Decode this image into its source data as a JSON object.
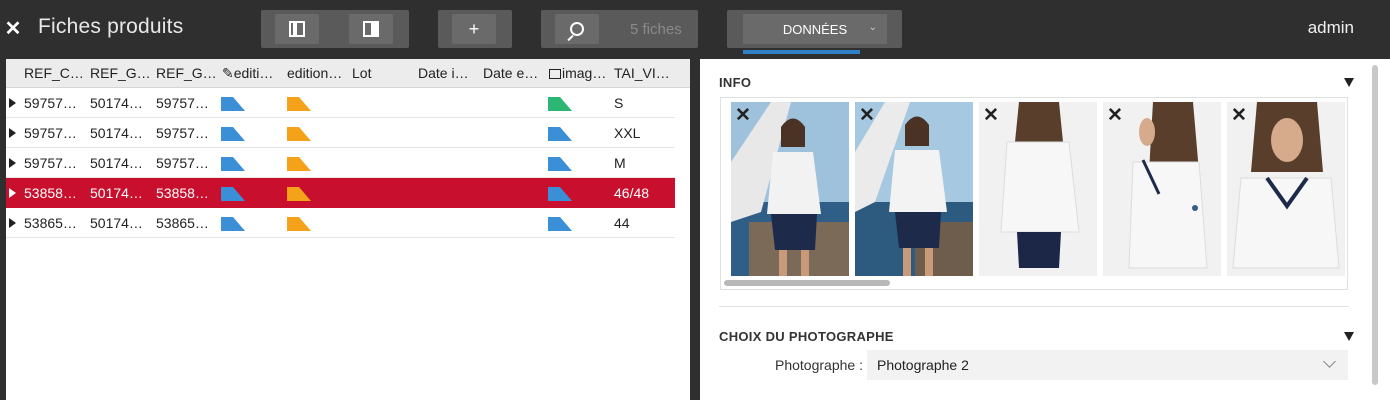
{
  "topbar": {
    "close_label": "✕",
    "title": "Fiches produits",
    "add_label": "+",
    "count_label": "5 fiches",
    "data_tab_label": "DONNÉES",
    "user": "admin"
  },
  "grid": {
    "columns": [
      "REF_C…",
      "REF_G…",
      "REF_G…",
      "editi…",
      "edition…",
      "Lot",
      "Date i…",
      "Date e…",
      "imag…",
      "TAI_VI…"
    ],
    "rows": [
      {
        "c1": "59757…",
        "c2": "50174…",
        "c3": "59757…",
        "size": "S",
        "image_flag_color": "#2bb673"
      },
      {
        "c1": "59757…",
        "c2": "50174…",
        "c3": "59757…",
        "size": "XXL",
        "image_flag_color": "#3b8fd6"
      },
      {
        "c1": "59757…",
        "c2": "50174…",
        "c3": "59757…",
        "size": "M",
        "image_flag_color": "#3b8fd6"
      },
      {
        "c1": "53858…",
        "c2": "50174…",
        "c3": "53858…",
        "size": "46/48",
        "image_flag_color": "#3b8fd6"
      },
      {
        "c1": "53865…",
        "c2": "50174…",
        "c3": "53865…",
        "size": "44",
        "image_flag_color": "#3b8fd6"
      }
    ],
    "edit_flag_color": "#3b8fd6",
    "edition_flag_color": "#f5a21b",
    "selected_row_color": "#c8102e"
  },
  "info": {
    "title": "INFO",
    "photo_remove_label": "✕"
  },
  "photographer": {
    "title": "CHOIX DU PHOTOGRAPHE",
    "label": "Photographe :",
    "value": "Photographe 2"
  }
}
